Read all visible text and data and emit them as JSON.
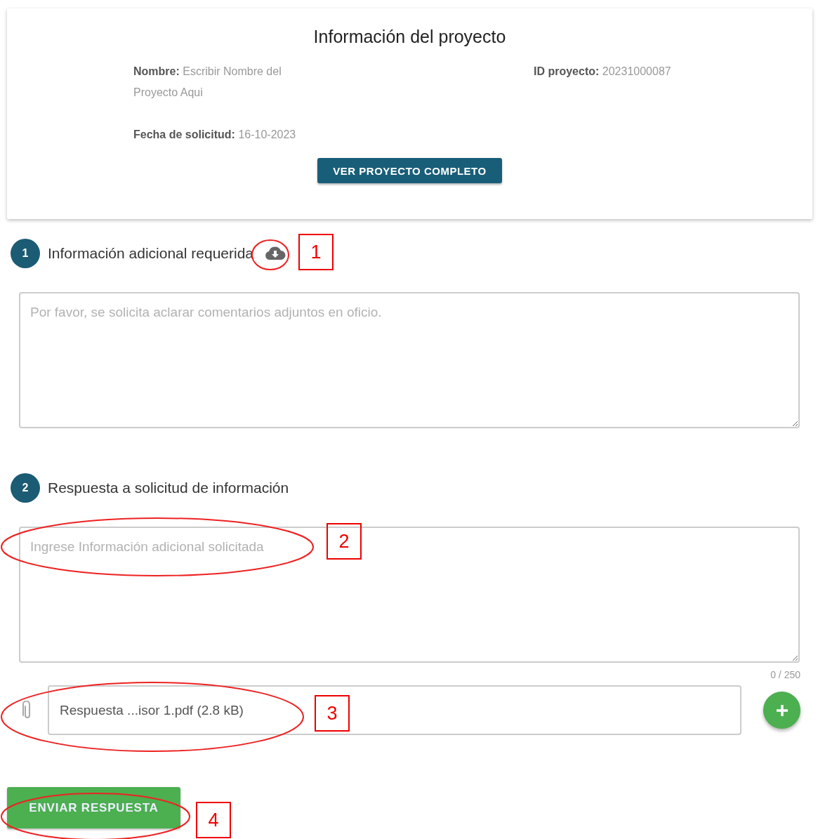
{
  "project_card": {
    "title": "Información del proyecto",
    "fields": [
      {
        "label": "Nombre:",
        "value": "Escribir Nombre del Proyecto Aqui"
      },
      {
        "label": "ID proyecto:",
        "value": "20231000087"
      },
      {
        "label": "Fecha de solicitud:",
        "value": "16-10-2023"
      }
    ],
    "button": "VER PROYECTO COMPLETO"
  },
  "steps": [
    {
      "number": "1",
      "title": "Información adicional requerida",
      "placeholder": "Por favor, se solicita aclarar comentarios adjuntos en oficio.",
      "download_icon": true
    },
    {
      "number": "2",
      "title": "Respuesta a solicitud de información",
      "placeholder": "Ingrese Información adicional solicitada",
      "counter": "0 / 250",
      "download_icon": false
    }
  ],
  "attachment": {
    "file": "Respuesta ...isor 1.pdf (2.8 kB)"
  },
  "submit_button": "ENVIAR RESPUESTA",
  "annotations": [
    {
      "label": "1"
    },
    {
      "label": "2"
    },
    {
      "label": "3"
    },
    {
      "label": "4"
    }
  ]
}
